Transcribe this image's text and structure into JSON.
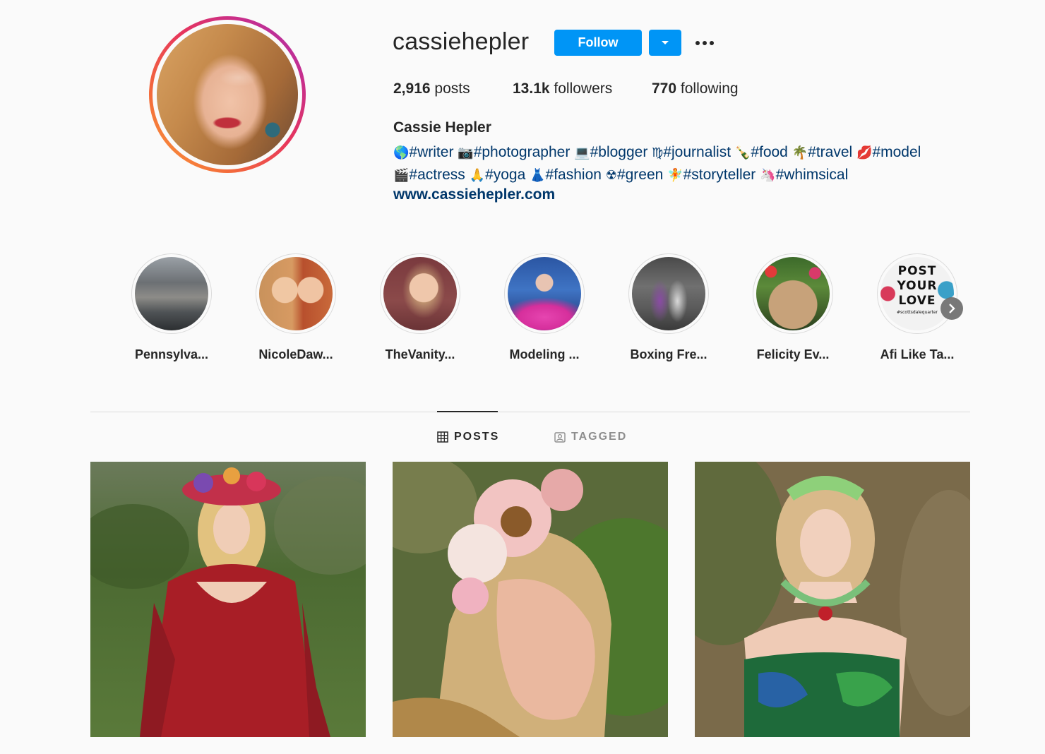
{
  "profile": {
    "username": "cassiehepler",
    "follow_label": "Follow",
    "stats": {
      "posts_count": "2,916",
      "posts_label": "posts",
      "followers_count": "13.1k",
      "followers_label": "followers",
      "following_count": "770",
      "following_label": "following"
    },
    "full_name": "Cassie Hepler",
    "bio_tags": [
      {
        "emoji": "🌎",
        "tag": "#writer"
      },
      {
        "emoji": "📷",
        "tag": "#photographer"
      },
      {
        "emoji": "💻",
        "tag": "#blogger"
      },
      {
        "emoji": "♍",
        "tag": "#journalist"
      },
      {
        "emoji": "🍾",
        "tag": "#food"
      },
      {
        "emoji": "🌴",
        "tag": "#travel"
      },
      {
        "emoji": "💋",
        "tag": "#model"
      },
      {
        "emoji": "🎬",
        "tag": "#actress"
      },
      {
        "emoji": "🙏",
        "tag": "#yoga"
      },
      {
        "emoji": "👗",
        "tag": "#fashion"
      },
      {
        "emoji": "☢",
        "tag": "#green"
      },
      {
        "emoji": "🧚",
        "tag": "#storyteller"
      },
      {
        "emoji": "🦄",
        "tag": "#whimsical"
      }
    ],
    "website": "www.cassiehepler.com"
  },
  "highlights": [
    {
      "label": "Pennsylva..."
    },
    {
      "label": "NicoleDaw..."
    },
    {
      "label": "TheVanity..."
    },
    {
      "label": "Modeling ..."
    },
    {
      "label": "Boxing Fre..."
    },
    {
      "label": "Felicity Ev..."
    },
    {
      "label": "Afi Like Ta...",
      "image_text": [
        "POST",
        "YOUR",
        "LOVE"
      ],
      "image_subtext": "#scottsdalequarter"
    }
  ],
  "tabs": {
    "posts_label": "POSTS",
    "tagged_label": "TAGGED"
  },
  "colors": {
    "accent": "#0095f6",
    "link": "#00376b",
    "text": "#262626",
    "muted": "#8e8e8e",
    "background": "#fafafa"
  }
}
